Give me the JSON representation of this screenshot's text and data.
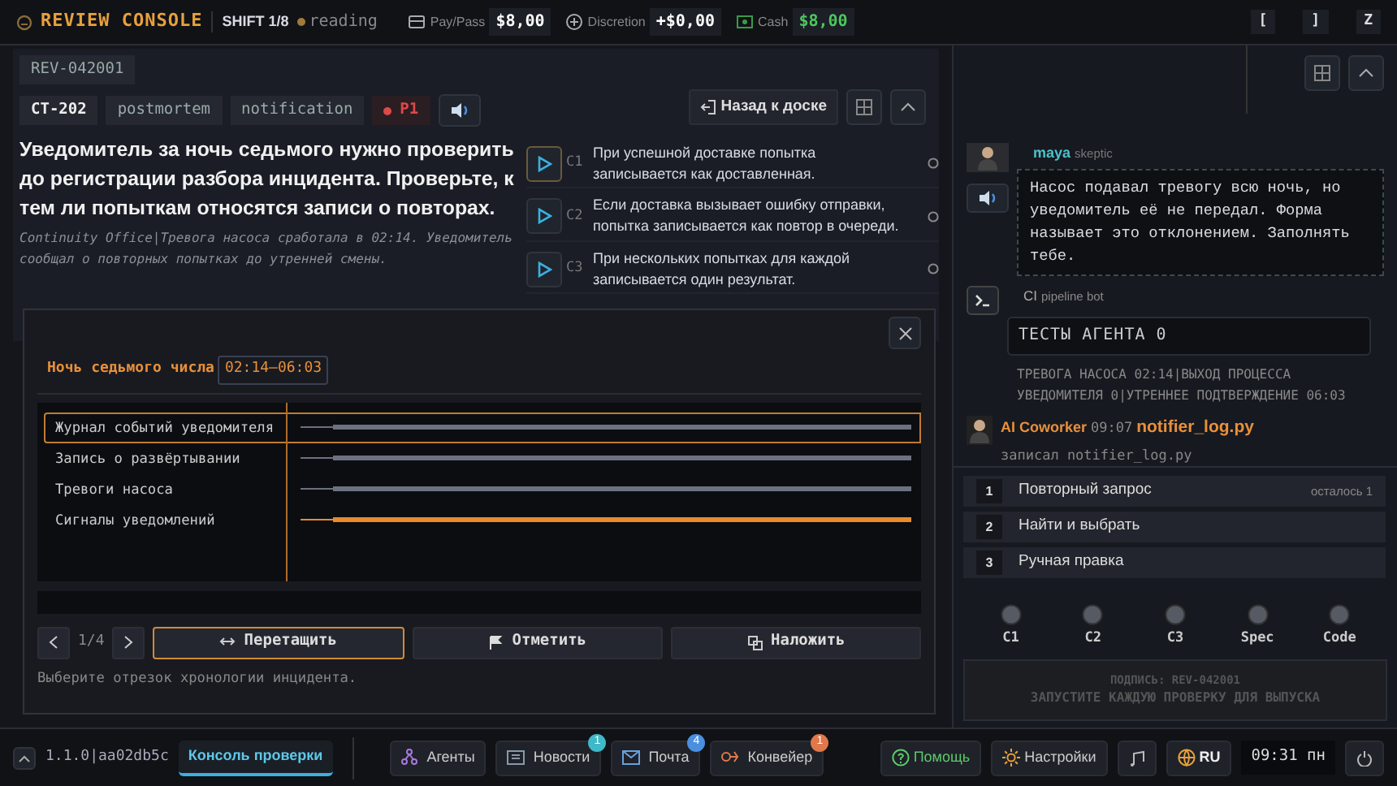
{
  "header": {
    "logo": "REVIEW CONSOLE",
    "shift": "SHIFT 1/8",
    "status": "reading",
    "stats": [
      {
        "kind": "pay",
        "label": "Pay/Pass",
        "value": "$8,00"
      },
      {
        "kind": "discretion",
        "label": "Discretion",
        "value": "+$0,00"
      },
      {
        "kind": "cash",
        "label": "Cash",
        "value": "$8,00"
      }
    ],
    "keys": [
      "[",
      "]",
      "Z"
    ]
  },
  "ticket": {
    "id": "REV-042001",
    "tags": [
      {
        "kind": "code",
        "text": "CT-202"
      },
      {
        "kind": "plain",
        "text": "postmortem"
      },
      {
        "kind": "plain",
        "text": "notification"
      },
      {
        "kind": "priority",
        "text": "P1"
      }
    ],
    "question": "Уведомитель за ночь седьмого нужно проверить до регистрации разбора инцидента. Проверьте, к тем ли попыткам относятся записи о повторах.",
    "note": "Continuity Office|Тревога насоса сработала в 02:14. Уведомитель сообщал о повторных попытках до утренней смены.",
    "back": "Назад к доске",
    "checks": [
      {
        "id": "C1",
        "text": "При успешной доставке попытка записывается как доставленная.",
        "selected": true,
        "checked": false
      },
      {
        "id": "C2",
        "text": "Если доставка вызывает ошибку отправки, попытка записывается как повтор в очереди.",
        "selected": false,
        "checked": false
      },
      {
        "id": "C3",
        "text": "При нескольких попытках для каждой записывается один результат.",
        "selected": false,
        "checked": false
      }
    ]
  },
  "modal": {
    "title": "Ночь седьмого числа",
    "range": "02:14–06:03",
    "tracks": [
      {
        "label": "Журнал событий уведомителя",
        "selected": true,
        "color": "#6b7180"
      },
      {
        "label": "Запись о развёртывании",
        "selected": false,
        "color": "#6b7180"
      },
      {
        "label": "Тревоги насоса",
        "selected": false,
        "color": "#6b7180"
      },
      {
        "label": "Сигналы уведомлений",
        "selected": false,
        "color": "#e88a2e"
      }
    ],
    "pager": "1/4",
    "tools": [
      {
        "kind": "drag",
        "label": "Перетащить",
        "selected": true
      },
      {
        "kind": "flag",
        "label": "Отметить",
        "selected": false
      },
      {
        "kind": "overlay",
        "label": "Наложить",
        "selected": false
      }
    ],
    "hint": "Выберите отрезок хронологии инцидента."
  },
  "chat": [
    {
      "kind": "person",
      "author": "maya",
      "role": "skeptic",
      "text": "Насос подавал тревогу всю ночь, но уведомитель её не передал. Форма называет это отклонением. Заполнять тебе."
    },
    {
      "kind": "bot",
      "author": "CI",
      "role": "pipeline bot",
      "title": "ТЕСТЫ АГЕНТА 0",
      "text": "ТРЕВОГА НАСОСА 02:14|ВЫХОД ПРОЦЕССА УВЕДОМИТЕЛЯ 0|УТРЕННЕЕ ПОДТВЕРЖДЕНИЕ 06:03"
    },
    {
      "kind": "coworker",
      "author": "AI Coworker",
      "time": "09:07",
      "file": "notifier_log.py",
      "text": "записал notifier_log.py"
    }
  ],
  "actions": [
    {
      "num": "1",
      "label": "Повторный запрос",
      "note": "осталось 1"
    },
    {
      "num": "2",
      "label": "Найти и выбрать"
    },
    {
      "num": "3",
      "label": "Ручная правка"
    }
  ],
  "gauges": [
    {
      "label": "C1",
      "on": false
    },
    {
      "label": "C2",
      "on": false
    },
    {
      "label": "C3",
      "on": false
    },
    {
      "label": "Spec",
      "on": false
    },
    {
      "label": "Code",
      "on": false
    }
  ],
  "release": {
    "sign": "ПОДПИСЬ: REV-042001",
    "text": "ЗАПУСТИТЕ КАЖДУЮ ПРОВЕРКУ ДЛЯ ВЫПУСКА",
    "disabled": true
  },
  "footer": {
    "version": "1.1.0|aa02db5c",
    "tab": "Консоль проверки",
    "apps": [
      {
        "kind": "agents",
        "label": "Агенты"
      },
      {
        "kind": "news",
        "label": "Новости",
        "badge": "1",
        "color": "#3fb8c8"
      },
      {
        "kind": "mail",
        "label": "Почта",
        "badge": "4",
        "color": "#4a8fe0"
      },
      {
        "kind": "pipeline",
        "label": "Конвейер",
        "badge": "1",
        "color": "#e0784a"
      }
    ],
    "help": "Помощь",
    "settings": "Настройки",
    "lang": "RU",
    "clock": "09:31 пн"
  }
}
